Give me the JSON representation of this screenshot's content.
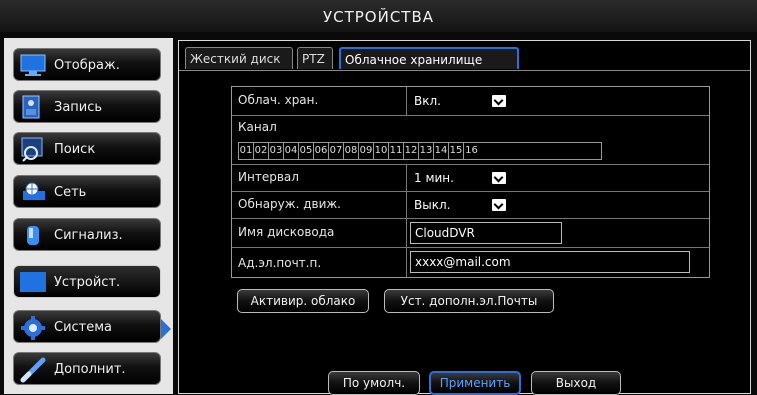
{
  "window": {
    "title": "УСТРОЙСТВА"
  },
  "sidebar": {
    "items": [
      {
        "label": "Отображ.",
        "icon": "monitor-icon"
      },
      {
        "label": "Запись",
        "icon": "record-icon"
      },
      {
        "label": "Поиск",
        "icon": "search-icon"
      },
      {
        "label": "Сеть",
        "icon": "network-icon"
      },
      {
        "label": "Сигнализ.",
        "icon": "alarm-icon"
      },
      {
        "label": "Устройст.",
        "icon": "device-icon",
        "active": true
      },
      {
        "label": "Система",
        "icon": "system-gear-icon"
      },
      {
        "label": "Дополнит.",
        "icon": "advanced-icon"
      }
    ]
  },
  "tabs": [
    {
      "label": "Жесткий диск"
    },
    {
      "label": "PTZ"
    },
    {
      "label": "Облачное хранилище",
      "active": true
    }
  ],
  "form": {
    "cloud_label": "Облач. хран.",
    "cloud_value": "Вкл.",
    "channel_label": "Канал",
    "channels": [
      "01",
      "02",
      "03",
      "04",
      "05",
      "06",
      "07",
      "08",
      "09",
      "10",
      "11",
      "12",
      "13",
      "14",
      "15",
      "16"
    ],
    "interval_label": "Интервал",
    "interval_value": "1 мин.",
    "motion_label": "Обнаруж. движ.",
    "motion_value": "Выкл.",
    "drive_name_label": "Имя дисковода",
    "drive_name_value": "CloudDVR",
    "email_label": "Ад.эл.почт.п.",
    "email_value": "xxxx@mail.com"
  },
  "actions": {
    "activate_cloud": "Активир. облако",
    "extra_email": "Уст. дополн.эл.Почты"
  },
  "footer": {
    "default": "По умолч.",
    "apply": "Применить",
    "exit": "Выход"
  },
  "colors": {
    "accent": "#2d6fd8",
    "background": "#000000"
  }
}
